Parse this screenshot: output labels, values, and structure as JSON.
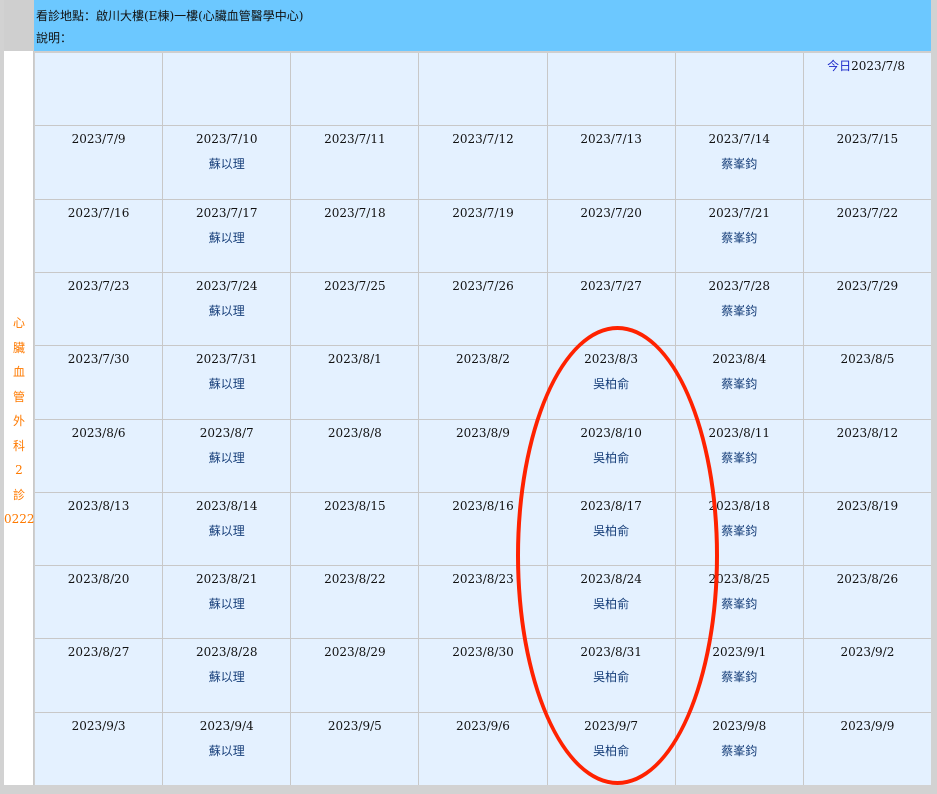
{
  "header": {
    "location_label": "看診地點：啟川大樓(E棟)一樓(心臟血管醫學中心)",
    "note_label": "說明："
  },
  "sidebar": {
    "clinic_chars": [
      "心",
      "臟",
      "血",
      "管",
      "外",
      "科",
      "2",
      "診",
      "0222"
    ]
  },
  "calendar": {
    "today_label": "今日",
    "today_date": "2023/7/8",
    "weeks": [
      [
        {
          "date": "",
          "doctor": ""
        },
        {
          "date": "",
          "doctor": ""
        },
        {
          "date": "",
          "doctor": ""
        },
        {
          "date": "",
          "doctor": ""
        },
        {
          "date": "",
          "doctor": ""
        },
        {
          "date": "",
          "doctor": ""
        },
        {
          "date": "2023/7/8",
          "doctor": ""
        }
      ],
      [
        {
          "date": "2023/7/9",
          "doctor": ""
        },
        {
          "date": "2023/7/10",
          "doctor": "蘇以理"
        },
        {
          "date": "2023/7/11",
          "doctor": ""
        },
        {
          "date": "2023/7/12",
          "doctor": ""
        },
        {
          "date": "2023/7/13",
          "doctor": ""
        },
        {
          "date": "2023/7/14",
          "doctor": "蔡峯鈞"
        },
        {
          "date": "2023/7/15",
          "doctor": ""
        }
      ],
      [
        {
          "date": "2023/7/16",
          "doctor": ""
        },
        {
          "date": "2023/7/17",
          "doctor": "蘇以理"
        },
        {
          "date": "2023/7/18",
          "doctor": ""
        },
        {
          "date": "2023/7/19",
          "doctor": ""
        },
        {
          "date": "2023/7/20",
          "doctor": ""
        },
        {
          "date": "2023/7/21",
          "doctor": "蔡峯鈞"
        },
        {
          "date": "2023/7/22",
          "doctor": ""
        }
      ],
      [
        {
          "date": "2023/7/23",
          "doctor": ""
        },
        {
          "date": "2023/7/24",
          "doctor": "蘇以理"
        },
        {
          "date": "2023/7/25",
          "doctor": ""
        },
        {
          "date": "2023/7/26",
          "doctor": ""
        },
        {
          "date": "2023/7/27",
          "doctor": ""
        },
        {
          "date": "2023/7/28",
          "doctor": "蔡峯鈞"
        },
        {
          "date": "2023/7/29",
          "doctor": ""
        }
      ],
      [
        {
          "date": "2023/7/30",
          "doctor": ""
        },
        {
          "date": "2023/7/31",
          "doctor": "蘇以理"
        },
        {
          "date": "2023/8/1",
          "doctor": ""
        },
        {
          "date": "2023/8/2",
          "doctor": ""
        },
        {
          "date": "2023/8/3",
          "doctor": "吳柏俞"
        },
        {
          "date": "2023/8/4",
          "doctor": "蔡峯鈞"
        },
        {
          "date": "2023/8/5",
          "doctor": ""
        }
      ],
      [
        {
          "date": "2023/8/6",
          "doctor": ""
        },
        {
          "date": "2023/8/7",
          "doctor": "蘇以理"
        },
        {
          "date": "2023/8/8",
          "doctor": ""
        },
        {
          "date": "2023/8/9",
          "doctor": ""
        },
        {
          "date": "2023/8/10",
          "doctor": "吳柏俞"
        },
        {
          "date": "2023/8/11",
          "doctor": "蔡峯鈞"
        },
        {
          "date": "2023/8/12",
          "doctor": ""
        }
      ],
      [
        {
          "date": "2023/8/13",
          "doctor": ""
        },
        {
          "date": "2023/8/14",
          "doctor": "蘇以理"
        },
        {
          "date": "2023/8/15",
          "doctor": ""
        },
        {
          "date": "2023/8/16",
          "doctor": ""
        },
        {
          "date": "2023/8/17",
          "doctor": "吳柏俞"
        },
        {
          "date": "2023/8/18",
          "doctor": "蔡峯鈞"
        },
        {
          "date": "2023/8/19",
          "doctor": ""
        }
      ],
      [
        {
          "date": "2023/8/20",
          "doctor": ""
        },
        {
          "date": "2023/8/21",
          "doctor": "蘇以理"
        },
        {
          "date": "2023/8/22",
          "doctor": ""
        },
        {
          "date": "2023/8/23",
          "doctor": ""
        },
        {
          "date": "2023/8/24",
          "doctor": "吳柏俞"
        },
        {
          "date": "2023/8/25",
          "doctor": "蔡峯鈞"
        },
        {
          "date": "2023/8/26",
          "doctor": ""
        }
      ],
      [
        {
          "date": "2023/8/27",
          "doctor": ""
        },
        {
          "date": "2023/8/28",
          "doctor": "蘇以理"
        },
        {
          "date": "2023/8/29",
          "doctor": ""
        },
        {
          "date": "2023/8/30",
          "doctor": ""
        },
        {
          "date": "2023/8/31",
          "doctor": "吳柏俞"
        },
        {
          "date": "2023/9/1",
          "doctor": "蔡峯鈞"
        },
        {
          "date": "2023/9/2",
          "doctor": ""
        }
      ],
      [
        {
          "date": "2023/9/3",
          "doctor": ""
        },
        {
          "date": "2023/9/4",
          "doctor": "蘇以理"
        },
        {
          "date": "2023/9/5",
          "doctor": ""
        },
        {
          "date": "2023/9/6",
          "doctor": ""
        },
        {
          "date": "2023/9/7",
          "doctor": "吳柏俞"
        },
        {
          "date": "2023/9/8",
          "doctor": "蔡峯鈞"
        },
        {
          "date": "2023/9/9",
          "doctor": ""
        }
      ]
    ]
  },
  "colors": {
    "header_bg": "#6cc8ff",
    "cell_bg": "#e4f1ff",
    "clinic_label": "#ff7a00",
    "doctor_link": "#173f7a",
    "today_label": "#1a27c9",
    "highlight_circle": "#ff2200"
  }
}
